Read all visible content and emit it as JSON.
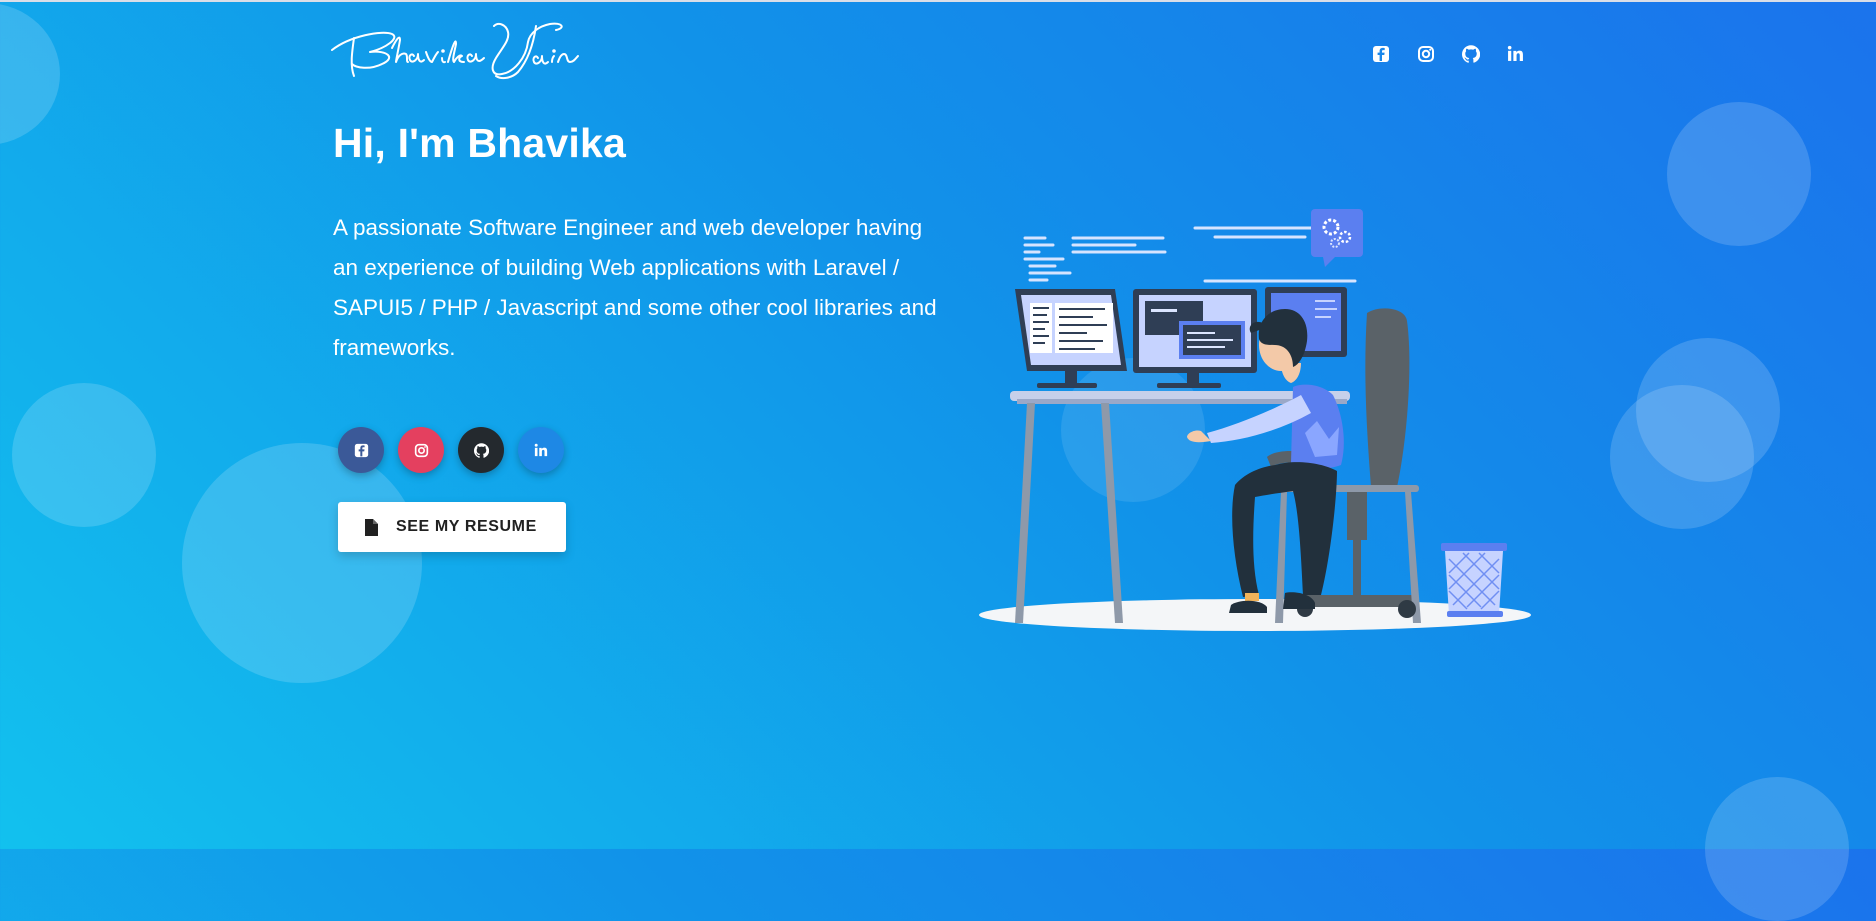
{
  "header": {
    "logo_text": "Bhavika Jain",
    "social_links": [
      {
        "name": "facebook",
        "icon": "facebook-icon"
      },
      {
        "name": "instagram",
        "icon": "instagram-icon"
      },
      {
        "name": "github",
        "icon": "github-icon"
      },
      {
        "name": "linkedin",
        "icon": "linkedin-icon"
      }
    ]
  },
  "hero": {
    "greeting": "Hi, I'm Bhavika",
    "intro": "A passionate Software Engineer and web developer having an experience of building Web applications with Laravel / SAPUI5 / PHP / Javascript and some other cool libraries and frameworks.",
    "social_buttons": [
      {
        "name": "facebook",
        "color": "#3b5998"
      },
      {
        "name": "instagram",
        "color": "#e4405f"
      },
      {
        "name": "github",
        "color": "#24292e"
      },
      {
        "name": "linkedin",
        "color": "#1e88e5"
      }
    ],
    "resume_button_label": "SEE MY RESUME",
    "illustration": "developer-at-desk-illustration"
  },
  "colors": {
    "gradient_start": "#12c1ee",
    "gradient_end": "#1b73ec",
    "accent_blue": "#5b7ff0"
  }
}
